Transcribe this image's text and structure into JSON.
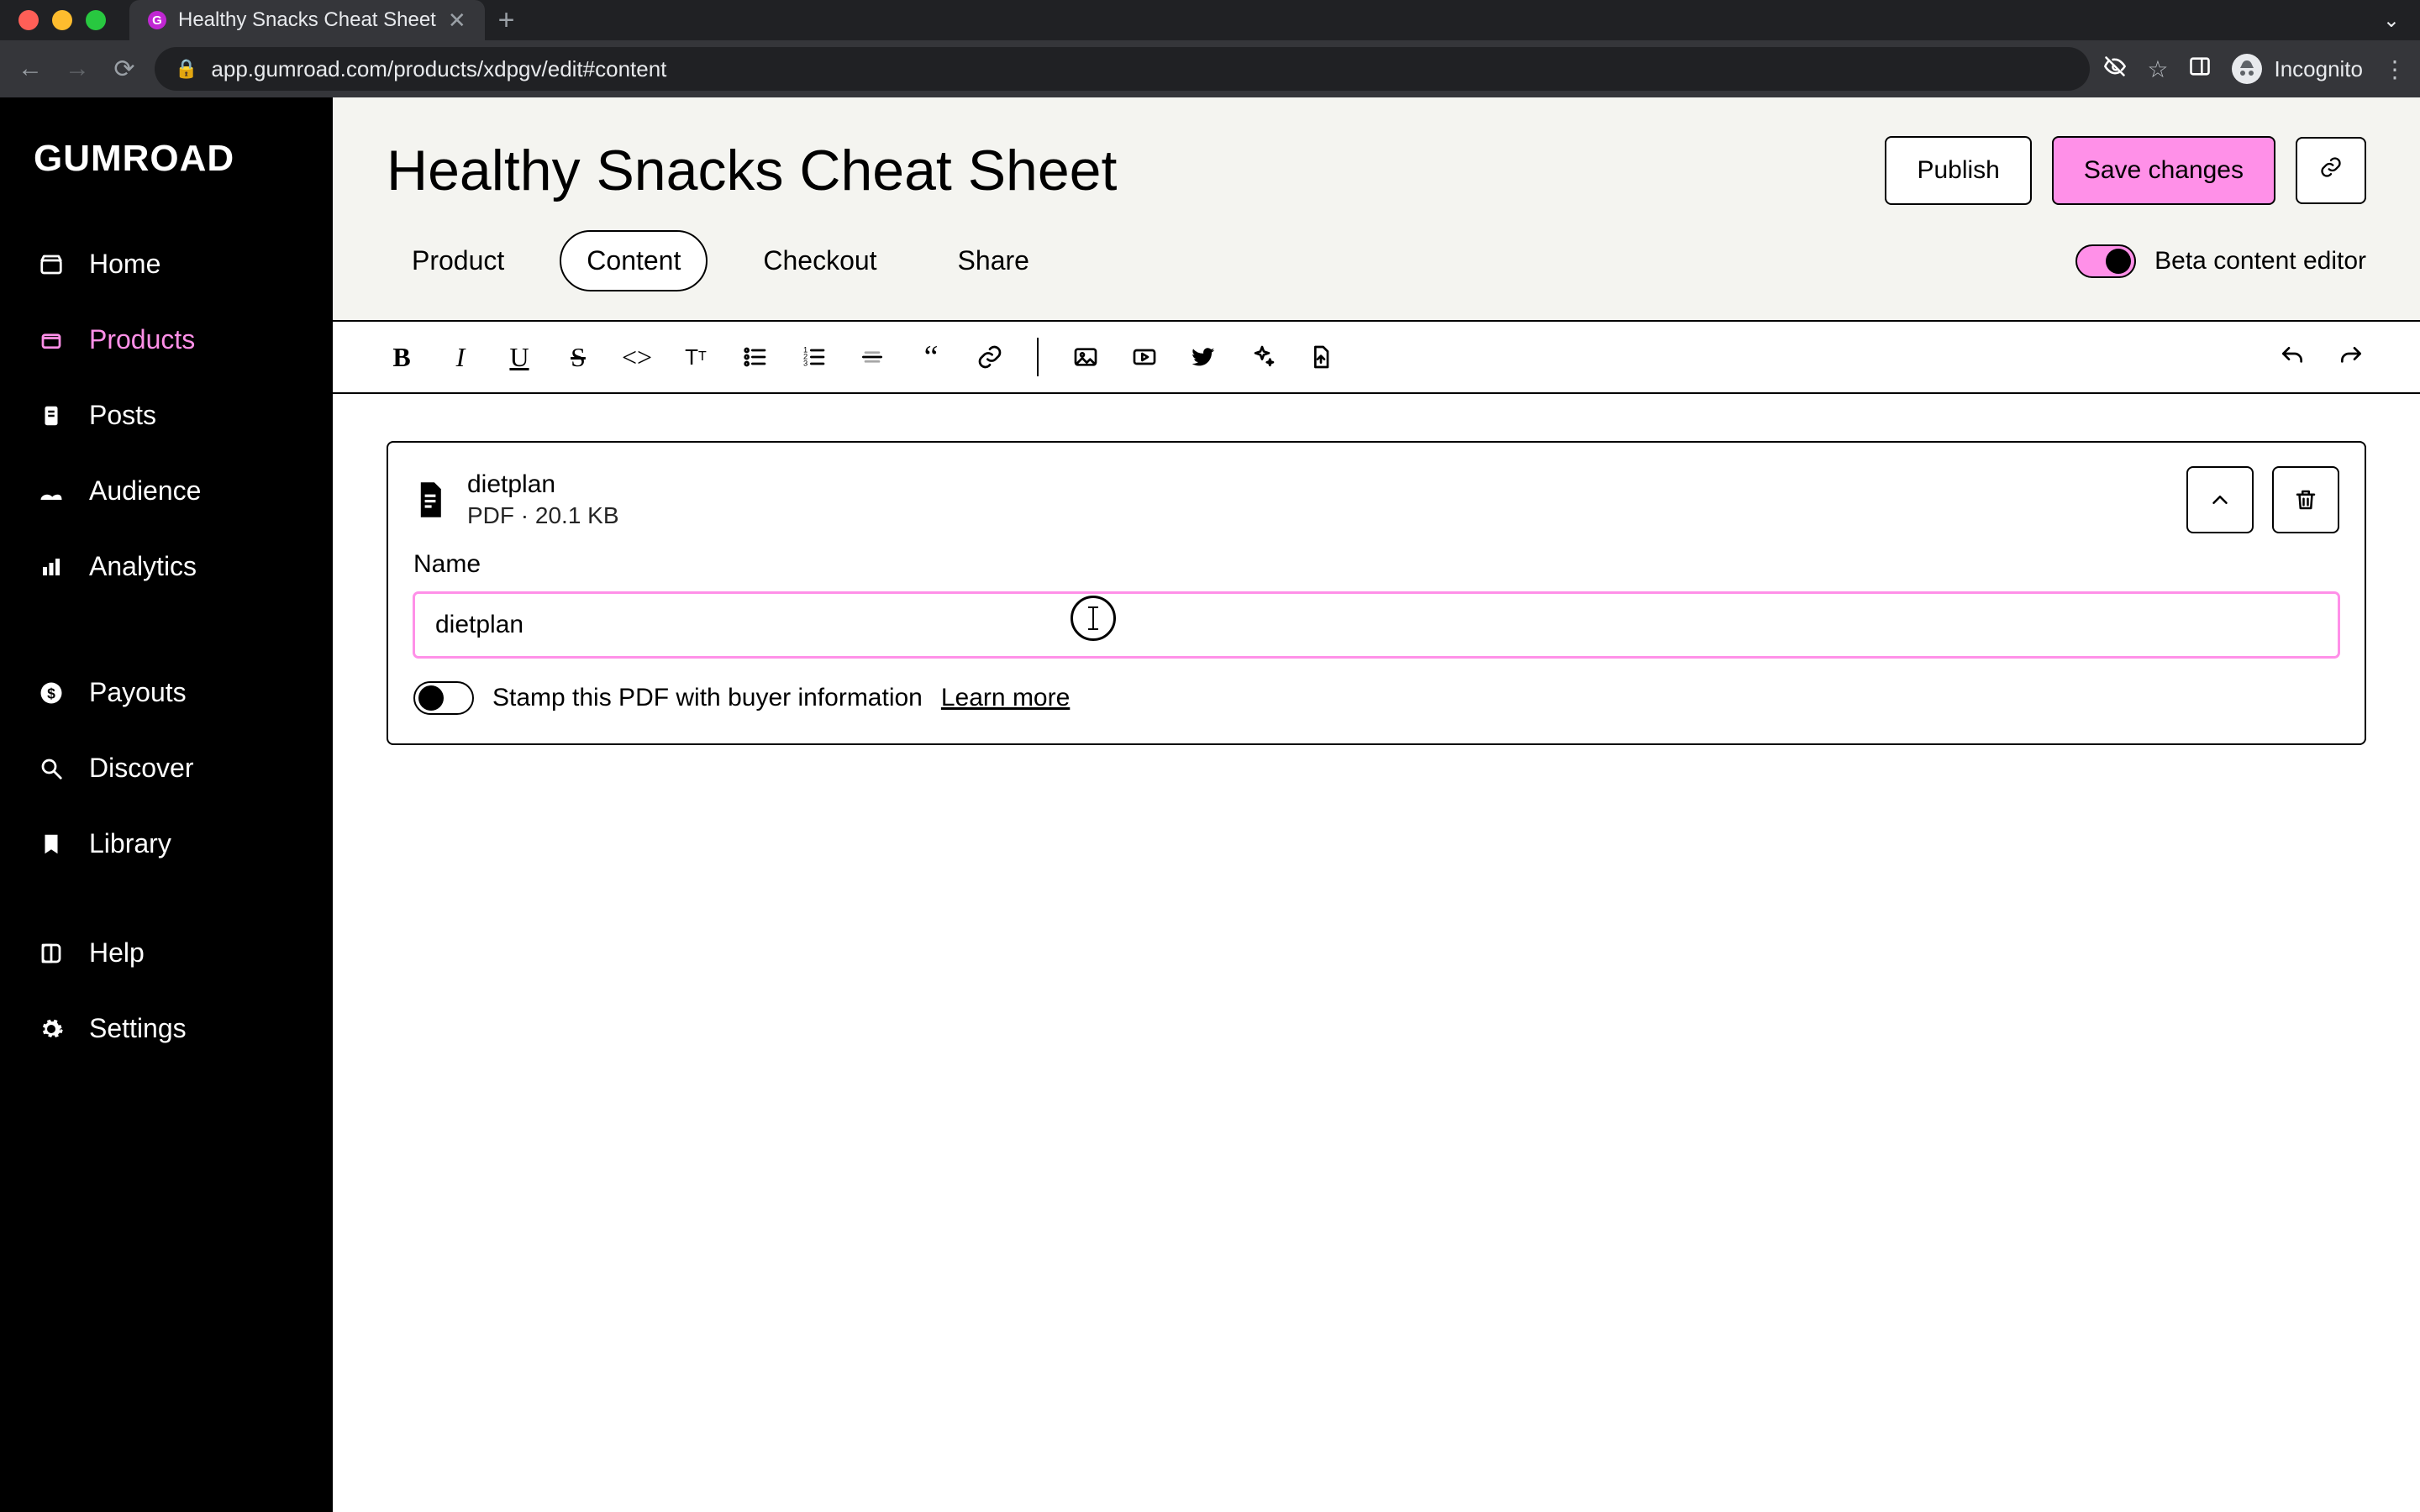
{
  "browser": {
    "tab_title": "Healthy Snacks Cheat Sheet",
    "url": "app.gumroad.com/products/xdpgv/edit#content",
    "incognito_label": "Incognito"
  },
  "brand": {
    "logo_text": "GUMROAD"
  },
  "sidebar": {
    "items": [
      {
        "label": "Home"
      },
      {
        "label": "Products"
      },
      {
        "label": "Posts"
      },
      {
        "label": "Audience"
      },
      {
        "label": "Analytics"
      },
      {
        "label": "Payouts"
      },
      {
        "label": "Discover"
      },
      {
        "label": "Library"
      },
      {
        "label": "Help"
      },
      {
        "label": "Settings"
      }
    ]
  },
  "page": {
    "title": "Healthy Snacks Cheat Sheet",
    "actions": {
      "publish": "Publish",
      "save": "Save changes"
    },
    "tabs": {
      "product": "Product",
      "content": "Content",
      "checkout": "Checkout",
      "share": "Share"
    },
    "beta_label": "Beta content editor"
  },
  "editor": {
    "file": {
      "name": "dietplan",
      "type": "PDF",
      "size": "20.1 KB"
    },
    "name_field_label": "Name",
    "name_field_value": "dietplan",
    "stamp_label": "Stamp this PDF with buyer information",
    "learn_more": "Learn more",
    "stamp_enabled": false
  },
  "colors": {
    "accent": "#ff90e8",
    "bg": "#f4f4f0"
  }
}
